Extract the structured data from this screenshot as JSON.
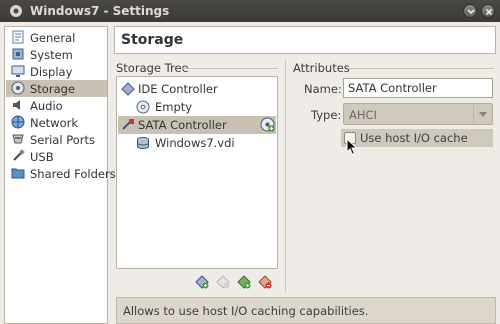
{
  "window": {
    "title": "Windows7 - Settings",
    "minimize_icon": "chevron-down-icon",
    "close_icon": "close-icon"
  },
  "sidebar": {
    "items": [
      {
        "label": "General",
        "icon": "general-icon"
      },
      {
        "label": "System",
        "icon": "system-icon"
      },
      {
        "label": "Display",
        "icon": "display-icon"
      },
      {
        "label": "Storage",
        "icon": "storage-icon",
        "selected": true
      },
      {
        "label": "Audio",
        "icon": "audio-icon"
      },
      {
        "label": "Network",
        "icon": "network-icon"
      },
      {
        "label": "Serial Ports",
        "icon": "serial-ports-icon"
      },
      {
        "label": "USB",
        "icon": "usb-icon"
      },
      {
        "label": "Shared Folders",
        "icon": "shared-folders-icon"
      }
    ]
  },
  "page": {
    "title": "Storage"
  },
  "storage_tree": {
    "heading": "Storage Tree",
    "rows": [
      {
        "label": "IDE Controller",
        "icon": "ide-controller-icon"
      },
      {
        "label": "Empty",
        "icon": "cd-icon"
      },
      {
        "label": "SATA Controller",
        "icon": "sata-controller-icon",
        "selected": true
      },
      {
        "label": "Windows7.vdi",
        "icon": "hard-disk-icon"
      }
    ],
    "add_attachment_icon": "add-disk-icon",
    "toolbar": [
      "add-controller-icon",
      "remove-controller-icon",
      "add-attachment-icon",
      "remove-attachment-icon"
    ]
  },
  "attributes": {
    "heading": "Attributes",
    "name_label": "Name:",
    "name_value": "SATA Controller",
    "type_label": "Type:",
    "type_value": "AHCI",
    "cache_label": "Use host I/O cache",
    "cache_checked": false
  },
  "status": {
    "text": "Allows to use host I/O caching capabilities."
  },
  "colors": {
    "selection": "#c9c1b4",
    "titlebar": "#3b3a37",
    "window_bg": "#efebe7"
  }
}
